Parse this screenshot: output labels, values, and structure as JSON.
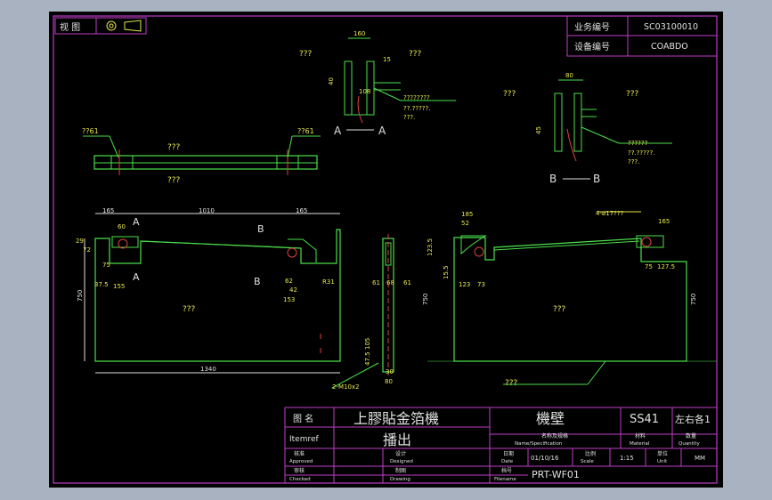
{
  "top_left": {
    "view_label": "视 图"
  },
  "top_right": {
    "business_no_label": "业务编号",
    "business_no_value": "SC03100010",
    "equipment_no_label": "设备编号",
    "equipment_no_value": "COABDO"
  },
  "annotations": {
    "q3": "???",
    "q61": "??61",
    "q7a": "????????",
    "q7b": "??.?????.",
    "q7c": "??????",
    "q3_dot": "???.",
    "phi17": "4-ø17???",
    "m10": "2-M10x2",
    "section_a": "A",
    "section_b": "B",
    "r31": "R31"
  },
  "dimensions": {
    "d160": "160",
    "d40": "40",
    "d10": "10",
    "d17": "17",
    "d15": "15",
    "d108": "108",
    "d5": "5",
    "d80": "80",
    "d6": "6",
    "d45": "45",
    "d165": "165",
    "d1010": "1010",
    "d165b": "165",
    "d29": "29",
    "d72": "72",
    "d60": "60",
    "d40b": "40",
    "d75": "75",
    "d80b": "80",
    "d155": "155",
    "d37_5": "37.5",
    "d750": "750",
    "d56": "56",
    "d135": "135",
    "d25": "25",
    "d105": "105",
    "d125": "125",
    "d79": "79",
    "d100": "100",
    "d62": "62",
    "d42": "42",
    "d153": "153",
    "d1340": "1340",
    "d61": "61",
    "d68": "68",
    "d105b": "105",
    "d47_5": "47.5",
    "d30": "30",
    "d80c": "80",
    "d185": "185",
    "d52": "52",
    "d123_5": "123.5",
    "d15_5": "15.5",
    "d123": "123",
    "d73": "73",
    "d750b": "750",
    "d75b": "75",
    "d127_5": "127.5",
    "d165c": "165",
    "d750c": "750"
  },
  "title_block": {
    "name_label": "图 名",
    "title_main": "上膠貼金箔機",
    "part_name": "機壁",
    "material_value": "SS41",
    "quantity_value": "左右各1",
    "item_ref_label": "Itemref",
    "subtitle": "播出",
    "name_spec_label": "名称及规格",
    "name_spec_en": "Name/Specification",
    "material_label": "材料",
    "material_en": "Material",
    "quantity_label": "数量",
    "quantity_en": "Quantity",
    "approved_label": "核准",
    "approved_en": "Approved",
    "designed_label": "设计",
    "designed_en": "Designed",
    "date_label": "日期",
    "date_en": "Date",
    "date_value": "01/10/16",
    "scale_label": "比例",
    "scale_en": "Scale",
    "scale_value": "1:15",
    "unit_label": "单位",
    "unit_en": "Unit",
    "unit_value": "MM",
    "checked_label": "审核",
    "checked_en": "Checked",
    "drawing_label": "制图",
    "drawing_en": "Drawing",
    "file_label": "档号",
    "file_en": "Filename",
    "file_value": "PRT-WF01"
  }
}
